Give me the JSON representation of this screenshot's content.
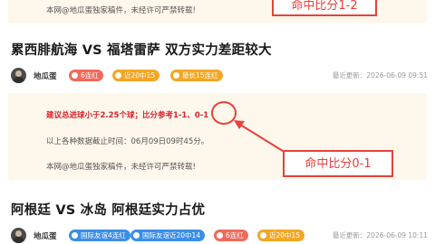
{
  "top_notice": {
    "copyright": "本网@地瓜蛋独家稿件，未经许可严禁转载!"
  },
  "top_callout": {
    "text": "命中比分1-2"
  },
  "articles": [
    {
      "title": "累西腓航海 VS 福塔雷萨 双方实力差距较大",
      "author": "地瓜蛋",
      "badges": [
        "6连红",
        "近20中15",
        "最长15连红"
      ],
      "updated": "最近更新：2026-06-09 09:51",
      "tip_prefix": "建议总进球小于2.25个球；比分参考1-1、",
      "tip_score": "0-1",
      "stats_note": "以上各种数据截止时间：06月09日09时45分。",
      "copyright": "本网@地瓜蛋独家稿件，未经许可严禁转载!",
      "callout": "命中比分0-1"
    },
    {
      "title": "阿根廷 VS 冰岛 阿根廷实力占优",
      "author": "地瓜蛋",
      "badges": [
        "国际友谊4连红",
        "国际友谊近20中14",
        "6连红",
        "近20中15"
      ],
      "updated": "最近更新：2026-06-09 10:11"
    }
  ],
  "colors": {
    "accent_red": "#e8413b",
    "notice_bg": "#fef7ec",
    "badge_red": "#f06a5a",
    "badge_orange": "#f5a623",
    "badge_blue": "#3b8ee8"
  }
}
